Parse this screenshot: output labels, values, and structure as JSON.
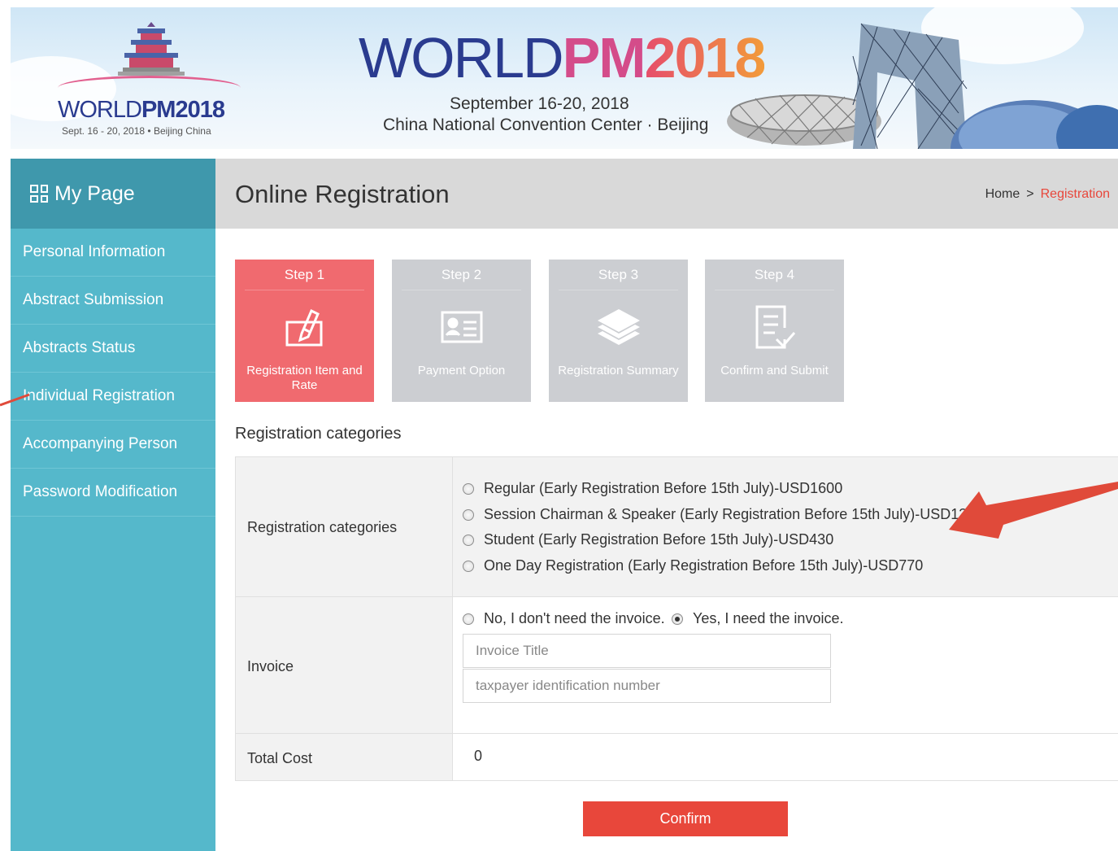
{
  "banner": {
    "logo_name_prefix": "WORLD",
    "logo_name_pm": "PM",
    "logo_name_year": "2018",
    "logo_sub": "Sept. 16 - 20, 2018 • Beijing China",
    "title_world": "WORLD",
    "title_pm": "PM",
    "title_year": "2018",
    "dates": "September 16-20, 2018",
    "venue": "China National Convention Center · Beijing"
  },
  "sidebar": {
    "header": "My Page",
    "items": [
      {
        "label": "Personal Information"
      },
      {
        "label": "Abstract Submission"
      },
      {
        "label": "Abstracts Status"
      },
      {
        "label": "Individual Registration"
      },
      {
        "label": "Accompanying Person"
      },
      {
        "label": "Password Modification"
      }
    ]
  },
  "page": {
    "title": "Online Registration",
    "breadcrumb": {
      "home": "Home",
      "separator": ">",
      "current": "Registration"
    }
  },
  "steps": [
    {
      "label": "Step 1",
      "desc": "Registration Item and Rate",
      "active": true
    },
    {
      "label": "Step 2",
      "desc": "Payment Option",
      "active": false
    },
    {
      "label": "Step 3",
      "desc": "Registration Summary",
      "active": false
    },
    {
      "label": "Step 4",
      "desc": "Confirm and Submit",
      "active": false
    }
  ],
  "form": {
    "section_title": "Registration categories",
    "categories": {
      "label": "Registration categories",
      "options": [
        "Regular (Early Registration Before 15th July)-USD1600",
        "Session Chairman & Speaker (Early Registration Before 15th July)-USD1300",
        "Student (Early Registration Before 15th July)-USD430",
        "One Day Registration (Early Registration Before 15th July)-USD770"
      ]
    },
    "invoice": {
      "label": "Invoice",
      "option_no": "No, I don't need the invoice.",
      "option_yes": "Yes, I need the invoice.",
      "selected": "yes",
      "title_placeholder": "Invoice Title",
      "taxpayer_placeholder": "taxpayer identification number"
    },
    "total": {
      "label": "Total Cost",
      "value": "0"
    },
    "confirm_label": "Confirm"
  },
  "colors": {
    "sidebar": "#55b8cb",
    "sidebar_header": "#3f98ac",
    "active_step": "#f06a6f",
    "inactive_step": "#ccced2",
    "accent_red": "#e8473b"
  }
}
